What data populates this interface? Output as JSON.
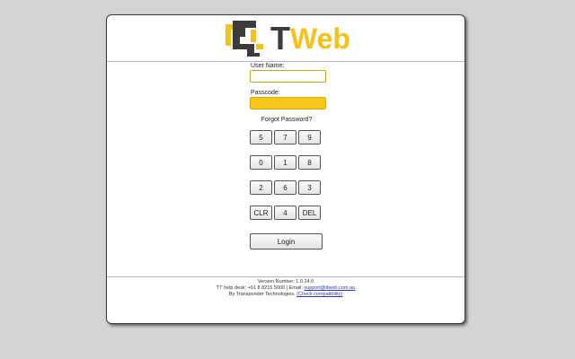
{
  "logo": {
    "t_text": "T",
    "web_text": "Web",
    "colors": {
      "dark": "#3b3b3b",
      "accent": "#f4c21a"
    }
  },
  "form": {
    "username_label": "User Name:",
    "username_value": "",
    "passcode_label": "Passcode:",
    "passcode_value": "",
    "forgot_label": "Forgot Password?"
  },
  "keypad": {
    "rows": [
      [
        "5",
        "7",
        "9"
      ],
      [
        "0",
        "1",
        "8"
      ],
      [
        "2",
        "6",
        "3"
      ],
      [
        "CLR",
        "4",
        "DEL"
      ]
    ]
  },
  "login_label": "Login",
  "footer": {
    "version": "Version Number: 1.0.24.0",
    "helpdesk_prefix": "TT help desk: +61 8 8215 5000 | Email: ",
    "email": "support@ttweb.com.au",
    "by_prefix": "By Transponder Technologies. ",
    "compat_link": "(Check compatibility)"
  }
}
